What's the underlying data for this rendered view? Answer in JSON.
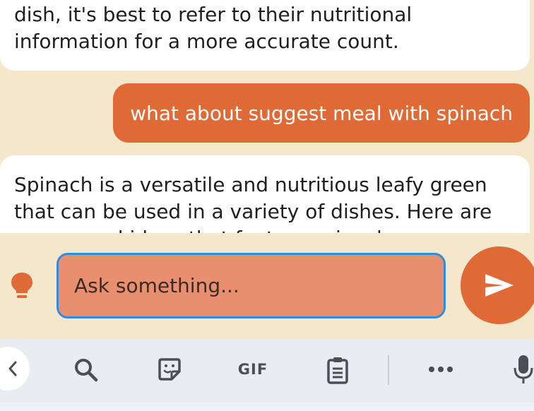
{
  "chat": {
    "messages": [
      {
        "role": "assistant",
        "text": "dish, it's best to refer to their nutritional information for a more accurate count."
      },
      {
        "role": "user",
        "text": "what about suggest meal with spinach"
      },
      {
        "role": "assistant",
        "text": "Spinach is a versatile and nutritious leafy green that can be used in a variety of dishes. Here are some meal ideas that feature spinach:"
      }
    ]
  },
  "composer": {
    "placeholder": "Ask something...",
    "hint_icon": "lightbulb-icon",
    "send_icon": "send-icon"
  },
  "keyboard": {
    "gif_label": "GIF",
    "icons": [
      "back-arrow-icon",
      "search-icon",
      "sticker-icon",
      "gif-icon",
      "clipboard-icon",
      "more-icon",
      "microphone-icon"
    ]
  },
  "colors": {
    "background": "#f5e7cb",
    "accent": "#df6a35",
    "input_fill": "#e98f6f",
    "focus_border": "#2f8de0",
    "keyboard_bar": "#e9edf2"
  }
}
